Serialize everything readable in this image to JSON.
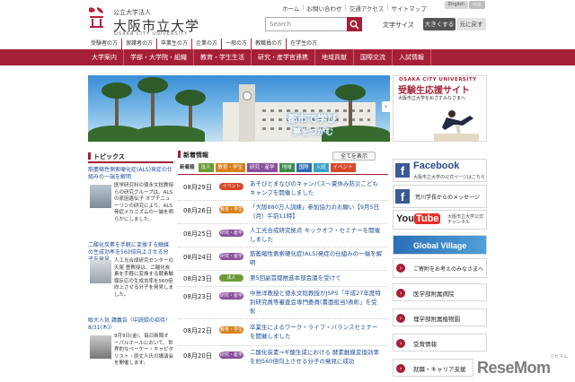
{
  "header": {
    "logo_small": "公立大学法人",
    "logo_big": "大阪市立大学",
    "logo_en": "OSAKA CITY UNIVERSITY",
    "top_links": [
      "ホーム",
      "お問い合わせ",
      "交通アクセス",
      "サイトマップ"
    ],
    "lang": [
      "English",
      "中文"
    ],
    "search_placeholder": "Search",
    "font_size_label": "文字サイズ",
    "font_large": "大きくする",
    "font_reset": "元に戻す"
  },
  "audience_nav": [
    "受験者の方",
    "保護者の方",
    "卒業生の方",
    "企業の方",
    "一般の方",
    "教職員の方",
    "在学生の方"
  ],
  "main_nav": [
    "大学案内",
    "学部・大学院・組織",
    "教育・学生生活",
    "研究・産学官連携",
    "地域貢献",
    "国際交流",
    "入試情報"
  ],
  "hero": {
    "line1": "都市で学び",
    "line2": "夢をつかむ",
    "side_banner": {
      "en": "OSAKA CITY UNIVERSITY",
      "title": "受験生応援サイト",
      "sub": "大阪市立大学をめざすみなさまへ"
    }
  },
  "topics": {
    "heading": "トピックス",
    "items": [
      {
        "title": "筋萎縮性側索硬化症(ALS)発症の仕組みの一端を解明",
        "body": "医学研究科の徳永文稔教授らの研究グループは、ALSの原因遺伝子 オプチニューリンの研究により、ALS発症メカニズムの一端を明らかにしました。"
      },
      {
        "title": "二酸化炭素を手軽に変換する触媒の生成効率を560倍向上させる分子を発見",
        "body": "人工光合成研究センターの天尾 豊教授は、二酸化炭素を手軽に変換する酵素触媒反応の生成効率を560倍向上させる分子を発見しました。"
      },
      {
        "title": "販大人気 講義告〈中読録の招待！8/31(木)〉",
        "body": "9月9日(金)、毎日新聞オーパルホールにおいて、世界的なベーケー・キャピタリスト・原丈人氏の講演会を開催します。"
      }
    ]
  },
  "news": {
    "heading": "新着情報",
    "all_button": "全てを表示",
    "categories": [
      {
        "label": "新着順",
        "color": "#ffffff"
      },
      {
        "label": "法人",
        "color": "#6d9b3a"
      },
      {
        "label": "教育・学生",
        "color": "#d9801c"
      },
      {
        "label": "研究・産学",
        "color": "#8a4e9c"
      },
      {
        "label": "地域",
        "color": "#3d8a4a"
      },
      {
        "label": "国際",
        "color": "#2c6db3"
      },
      {
        "label": "入試",
        "color": "#3aa0c9"
      },
      {
        "label": "イベント",
        "color": "#d64a2a"
      }
    ],
    "rows": [
      {
        "date": "08月29日",
        "tag": "イベント",
        "tag_color": "#d64a2a",
        "text": "あそびとまなびのキャンパス～夏休み防災こどもキャンプを開催しました"
      },
      {
        "date": "08月26日",
        "tag": "教育・学生",
        "tag_color": "#d9801c",
        "text": "「大阪880万人訓練」参加協力のお願い【9月5日（月）午前11時】"
      },
      {
        "date": "08月25日",
        "tag": "研究・産学",
        "tag_color": "#8a4e9c",
        "text": "人工光合成研究拠点 キックオフ・セミナーを開催しました"
      },
      {
        "date": "08月24日",
        "tag": "研究・産学",
        "tag_color": "#8a4e9c",
        "text": "筋萎縮性側索硬化症(ALS)発症の仕組みの一端を解明"
      },
      {
        "date": "08月23日",
        "tag": "法人",
        "tag_color": "#6d9b3a",
        "text": "第5回副首都推進本部会議を受けて"
      },
      {
        "date": "08月23日",
        "tag": "研究・産学",
        "tag_color": "#8a4e9c",
        "text": "中島洋教授と徳永文稔教授がJSPS「平成27年度特別研究員等審査会専門委員(書面担当)表彰」を受彰"
      },
      {
        "date": "08月22日",
        "tag": "教育・学生",
        "tag_color": "#d9801c",
        "text": "卒業生によるワーク・ライフ・バランスセミナーを開催しました"
      },
      {
        "date": "08月20日",
        "tag": "研究・産学",
        "tag_color": "#8a4e9c",
        "text": "二酸化炭素→ギ酸生成における 酵素触媒変換効率を約560倍向上させる分子の発見に成功"
      }
    ]
  },
  "right_links": {
    "facebook": {
      "title": "Facebook",
      "sub": "大阪市立大学の公式ページはこちら"
    },
    "president": "荒川学長からのメッセージ",
    "youtube": {
      "sub": "大阪市立大学公式チャンネル"
    },
    "global": "Global Village",
    "donation": "ご寄附をお考えのみなさまへ",
    "hospital": "医学部附属病院",
    "botanical": "理学部附属植物園",
    "awards": "受賞情報",
    "career": "就職・キャリア支援"
  },
  "watermark": {
    "small": "リセマム",
    "main": "ReseMom"
  }
}
